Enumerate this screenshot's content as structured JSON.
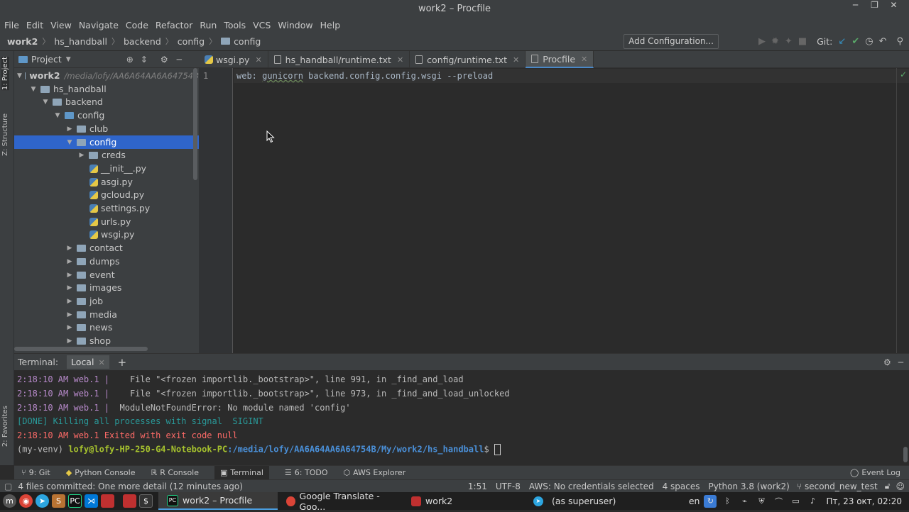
{
  "window": {
    "title": "work2 – Procfile",
    "controls": [
      "─",
      "❐",
      "✕"
    ]
  },
  "menu": [
    "File",
    "Edit",
    "View",
    "Navigate",
    "Code",
    "Refactor",
    "Run",
    "Tools",
    "VCS",
    "Window",
    "Help"
  ],
  "breadcrumb": [
    "work2",
    "hs_handball",
    "backend",
    "config",
    "config"
  ],
  "toolbar": {
    "add_config": "Add Configuration...",
    "git_label": "Git:"
  },
  "left_strip": {
    "project_tab": "1: Project",
    "structure_tab": "Z: Structure",
    "favorites_tab": "2: Favorites"
  },
  "project_panel": {
    "title": "Project",
    "tree": [
      {
        "label": "work2",
        "hint": "/media/lofy/AA6A64AA6A64754B",
        "type": "folder",
        "open": true,
        "depth": 0,
        "bold": true
      },
      {
        "label": "hs_handball",
        "type": "folder",
        "open": true,
        "depth": 1
      },
      {
        "label": "backend",
        "type": "folder",
        "open": true,
        "depth": 2
      },
      {
        "label": "config",
        "type": "folder-blue",
        "open": true,
        "depth": 3
      },
      {
        "label": "club",
        "type": "folder",
        "open": false,
        "depth": 4
      },
      {
        "label": "config",
        "type": "folder",
        "open": true,
        "depth": 4,
        "selected": true
      },
      {
        "label": "creds",
        "type": "folder",
        "open": false,
        "depth": 5
      },
      {
        "label": "__init__.py",
        "type": "py",
        "depth": 6
      },
      {
        "label": "asgi.py",
        "type": "py",
        "depth": 6
      },
      {
        "label": "gcloud.py",
        "type": "py",
        "depth": 6
      },
      {
        "label": "settings.py",
        "type": "py",
        "depth": 6
      },
      {
        "label": "urls.py",
        "type": "py",
        "depth": 6
      },
      {
        "label": "wsgi.py",
        "type": "py",
        "depth": 6
      },
      {
        "label": "contact",
        "type": "folder",
        "open": false,
        "depth": 4
      },
      {
        "label": "dumps",
        "type": "folder",
        "open": false,
        "depth": 4
      },
      {
        "label": "event",
        "type": "folder",
        "open": false,
        "depth": 4
      },
      {
        "label": "images",
        "type": "folder",
        "open": false,
        "depth": 4
      },
      {
        "label": "job",
        "type": "folder",
        "open": false,
        "depth": 4
      },
      {
        "label": "media",
        "type": "folder",
        "open": false,
        "depth": 4
      },
      {
        "label": "news",
        "type": "folder",
        "open": false,
        "depth": 4
      },
      {
        "label": "shop",
        "type": "folder",
        "open": false,
        "depth": 4
      }
    ]
  },
  "tabs": [
    {
      "label": "wsgi.py",
      "icon": "python-file-icon"
    },
    {
      "label": "hs_handball/runtime.txt",
      "icon": "text-file-icon"
    },
    {
      "label": "config/runtime.txt",
      "icon": "text-file-icon"
    },
    {
      "label": "Procfile",
      "icon": "text-file-icon",
      "active": true
    }
  ],
  "editor": {
    "line_number": "1",
    "code_prefix": "web: ",
    "code_underlined": "gunicorn",
    "code_rest": " backend.config.config.wsgi --preload"
  },
  "terminal": {
    "title": "Terminal:",
    "tab": "Local",
    "lines": [
      {
        "ts": "2:18:10 AM web.1 |",
        "text": "    File \"<frozen importlib._bootstrap>\", line 991, in _find_and_load"
      },
      {
        "ts": "2:18:10 AM web.1 |",
        "text": "    File \"<frozen importlib._bootstrap>\", line 973, in _find_and_load_unlocked"
      },
      {
        "ts": "2:18:10 AM web.1 |",
        "text": "  ModuleNotFoundError: No module named 'config'"
      }
    ],
    "done_line": "[DONE] Killing all processes with signal  SIGINT",
    "exit_line": "2:18:10 AM web.1 Exited with exit code null",
    "prompt_env": "(my-venv) ",
    "prompt_user": "lofy@lofy-HP-250-G4-Notebook-PC",
    "prompt_path": ":/media/lofy/AA6A64AA6A64754B/My/work2/hs_handball",
    "prompt_end": "$ "
  },
  "bottom_tools": [
    {
      "label": "9: Git",
      "icon": "git-icon"
    },
    {
      "label": "Python Console",
      "icon": "python-icon"
    },
    {
      "label": "R Console",
      "icon": "r-icon"
    },
    {
      "label": "Terminal",
      "icon": "terminal-icon",
      "active": true
    },
    {
      "label": "6: TODO",
      "icon": "todo-icon"
    },
    {
      "label": "AWS Explorer",
      "icon": "aws-icon"
    }
  ],
  "event_log": "Event Log",
  "status": {
    "message": "4 files committed: One more detail (12 minutes ago)",
    "position": "1:51",
    "encoding": "UTF-8",
    "aws": "AWS: No credentials selected",
    "indent": "4 spaces",
    "interpreter": "Python 3.8 (work2)",
    "branch": "second_new_test"
  },
  "taskbar": {
    "windows": [
      {
        "label": "work2 – Procfile",
        "icon": "pycharm-icon",
        "active": true
      },
      {
        "label": "Google Translate - Goo...",
        "icon": "chrome-icon"
      },
      {
        "label": "work2",
        "icon": "folder-icon"
      },
      {
        "label": "(as superuser)",
        "icon": "telegram-icon"
      }
    ],
    "lang": "en",
    "clock": "Пт, 23 окт, 02:20"
  }
}
